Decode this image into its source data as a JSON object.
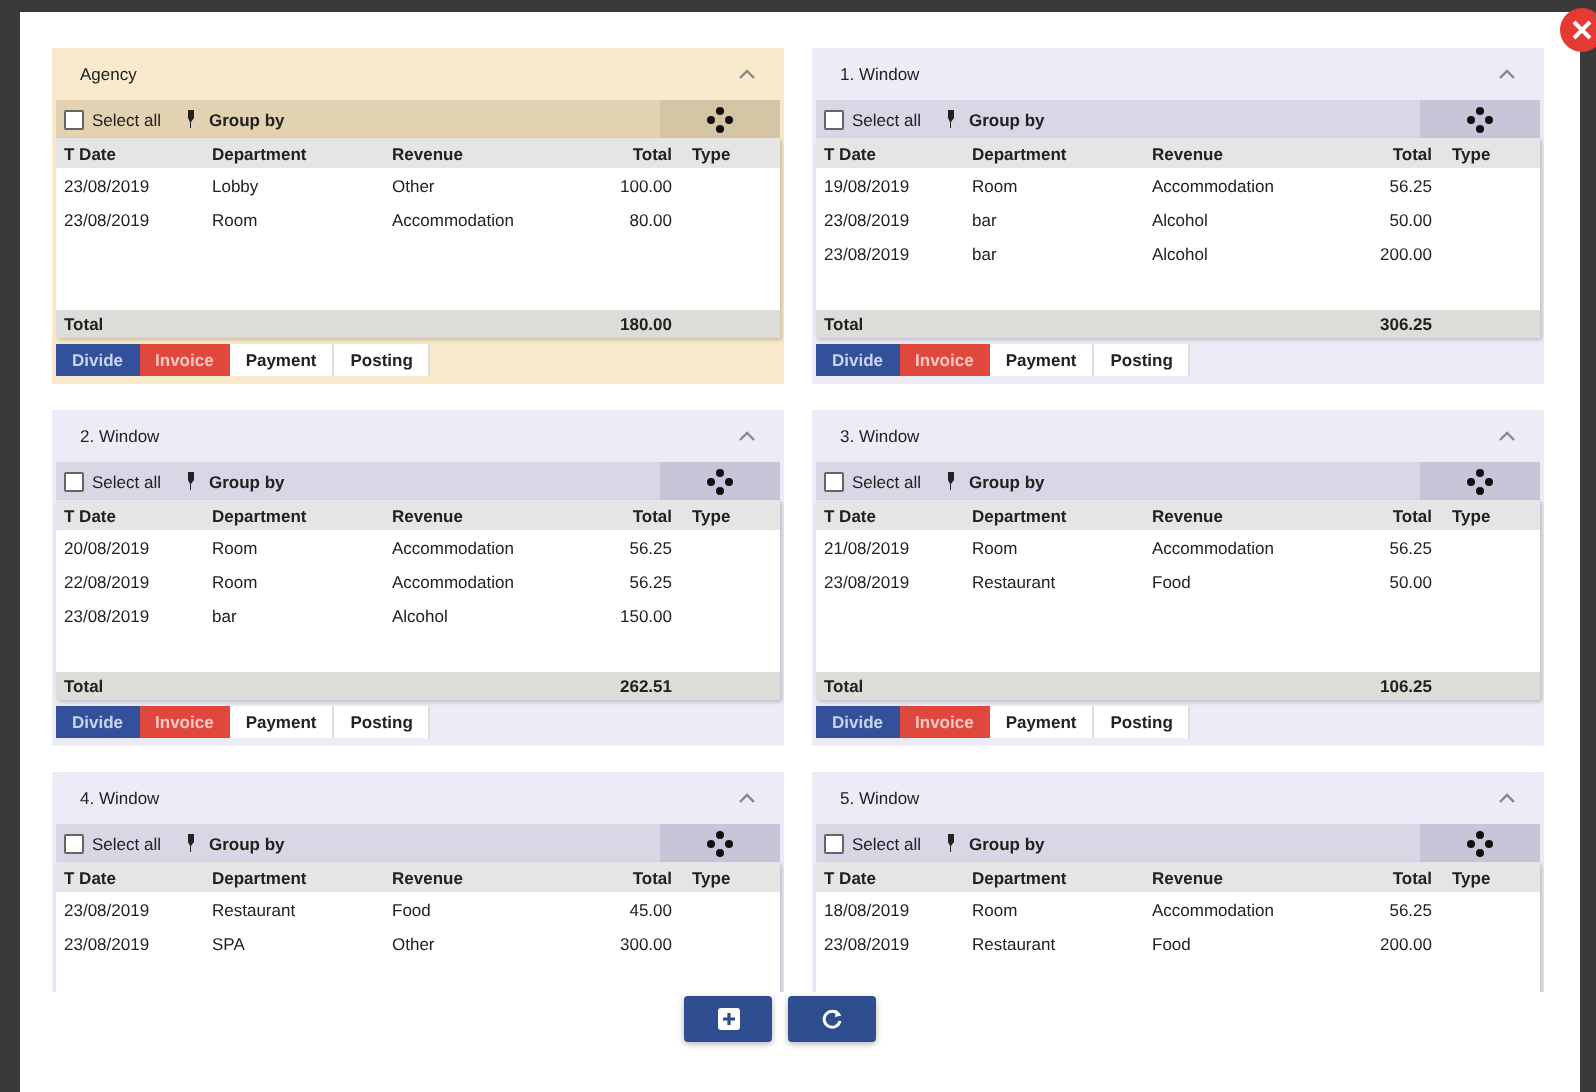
{
  "panels": [
    {
      "title": "Agency",
      "selected": true,
      "select_all": {
        "label": "Select all",
        "checked": false
      },
      "group_by": "Group by",
      "columns": [
        "T Date",
        "Department",
        "Revenue",
        "Total",
        "Type"
      ],
      "rows": [
        [
          "23/08/2019",
          "Lobby",
          "Other",
          "100.00"
        ],
        [
          "23/08/2019",
          "Room",
          "Accommodation",
          "80.00"
        ]
      ],
      "total": {
        "label": "Total",
        "value": "180.00"
      },
      "actions": [
        {
          "label": "Divide",
          "kind": "primary"
        },
        {
          "label": "Invoice",
          "kind": "danger"
        },
        {
          "label": "Payment",
          "kind": "plain"
        },
        {
          "label": "Posting",
          "kind": "plain"
        }
      ]
    },
    {
      "title": "1. Window",
      "selected": false,
      "select_all": {
        "label": "Select all",
        "checked": false
      },
      "group_by": "Group by",
      "columns": [
        "T Date",
        "Department",
        "Revenue",
        "Total",
        "Type"
      ],
      "rows": [
        [
          "19/08/2019",
          "Room",
          "Accommodation",
          "56.25"
        ],
        [
          "23/08/2019",
          "bar",
          "Alcohol",
          "50.00"
        ],
        [
          "23/08/2019",
          "bar",
          "Alcohol",
          "200.00"
        ]
      ],
      "total": {
        "label": "Total",
        "value": "306.25"
      },
      "actions": [
        {
          "label": "Divide",
          "kind": "primary"
        },
        {
          "label": "Invoice",
          "kind": "danger"
        },
        {
          "label": "Payment",
          "kind": "plain"
        },
        {
          "label": "Posting",
          "kind": "plain"
        }
      ]
    },
    {
      "title": "2. Window",
      "selected": false,
      "select_all": {
        "label": "Select all",
        "checked": false
      },
      "group_by": "Group by",
      "columns": [
        "T Date",
        "Department",
        "Revenue",
        "Total",
        "Type"
      ],
      "rows": [
        [
          "20/08/2019",
          "Room",
          "Accommodation",
          "56.25"
        ],
        [
          "22/08/2019",
          "Room",
          "Accommodation",
          "56.25"
        ],
        [
          "23/08/2019",
          "bar",
          "Alcohol",
          "150.00"
        ]
      ],
      "total": {
        "label": "Total",
        "value": "262.51"
      },
      "actions": [
        {
          "label": "Divide",
          "kind": "primary"
        },
        {
          "label": "Invoice",
          "kind": "danger"
        },
        {
          "label": "Payment",
          "kind": "plain"
        },
        {
          "label": "Posting",
          "kind": "plain"
        }
      ]
    },
    {
      "title": "3. Window",
      "selected": false,
      "select_all": {
        "label": "Select all",
        "checked": false
      },
      "group_by": "Group by",
      "columns": [
        "T Date",
        "Department",
        "Revenue",
        "Total",
        "Type"
      ],
      "rows": [
        [
          "21/08/2019",
          "Room",
          "Accommodation",
          "56.25"
        ],
        [
          "23/08/2019",
          "Restaurant",
          "Food",
          "50.00"
        ]
      ],
      "total": {
        "label": "Total",
        "value": "106.25"
      },
      "actions": [
        {
          "label": "Divide",
          "kind": "primary"
        },
        {
          "label": "Invoice",
          "kind": "danger"
        },
        {
          "label": "Payment",
          "kind": "plain"
        },
        {
          "label": "Posting",
          "kind": "plain"
        }
      ]
    },
    {
      "title": "4. Window",
      "selected": false,
      "select_all": {
        "label": "Select all",
        "checked": false
      },
      "group_by": "Group by",
      "columns": [
        "T Date",
        "Department",
        "Revenue",
        "Total",
        "Type"
      ],
      "rows": [
        [
          "23/08/2019",
          "Restaurant",
          "Food",
          "45.00"
        ],
        [
          "23/08/2019",
          "SPA",
          "Other",
          "300.00"
        ]
      ]
    },
    {
      "title": "5. Window",
      "selected": false,
      "select_all": {
        "label": "Select all",
        "checked": false
      },
      "group_by": "Group by",
      "columns": [
        "T Date",
        "Department",
        "Revenue",
        "Total",
        "Type"
      ],
      "rows": [
        [
          "18/08/2019",
          "Room",
          "Accommodation",
          "56.25"
        ],
        [
          "23/08/2019",
          "Restaurant",
          "Food",
          "200.00"
        ]
      ]
    }
  ]
}
